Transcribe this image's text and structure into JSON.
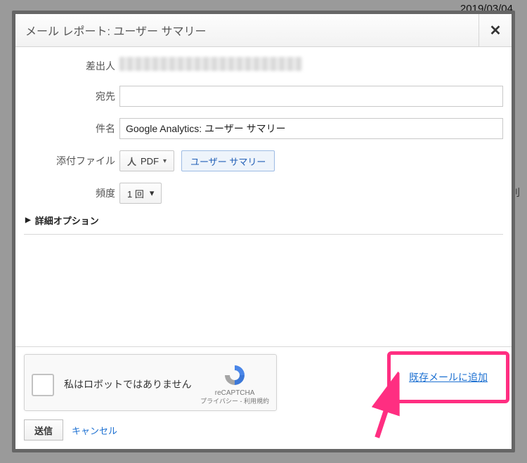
{
  "backdrop": {
    "date": "2019/03/04",
    "side_char": "別"
  },
  "dialog": {
    "title": "メール レポート: ユーザー サマリー",
    "close_icon": "✕",
    "from_label": "差出人",
    "to_label": "宛先",
    "to_value": "",
    "subject_label": "件名",
    "subject_value": "Google Analytics: ユーザー サマリー",
    "attachment_label": "添付ファイル",
    "attachment_format": "PDF",
    "attachment_chip": "ユーザー サマリー",
    "frequency_label": "頻度",
    "frequency_value": "1 回",
    "advanced_label": "詳細オプション",
    "captcha_text": "私はロボットではありません",
    "captcha_brand": "reCAPTCHA",
    "captcha_terms": "プライバシー - 利用規約",
    "send_label": "送信",
    "cancel_label": "キャンセル",
    "existing_link": "既存メールに追加"
  }
}
